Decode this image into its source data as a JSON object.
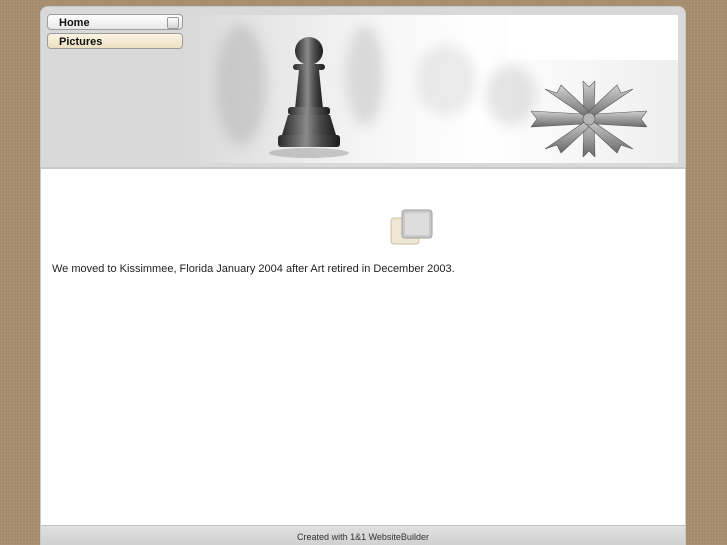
{
  "nav": {
    "items": [
      {
        "label": "Home"
      },
      {
        "label": "Pictures"
      }
    ]
  },
  "main": {
    "text": "We moved to Kissimmee, Florida January 2004 after Art retired in December 2003."
  },
  "footer": {
    "text": "Created with 1&1 WebsiteBuilder"
  },
  "icons": {
    "banner_pawn": "chess-pawn-icon",
    "banner_logo": "compass-arrows-icon",
    "placeholder": "image-placeholder-icon"
  }
}
